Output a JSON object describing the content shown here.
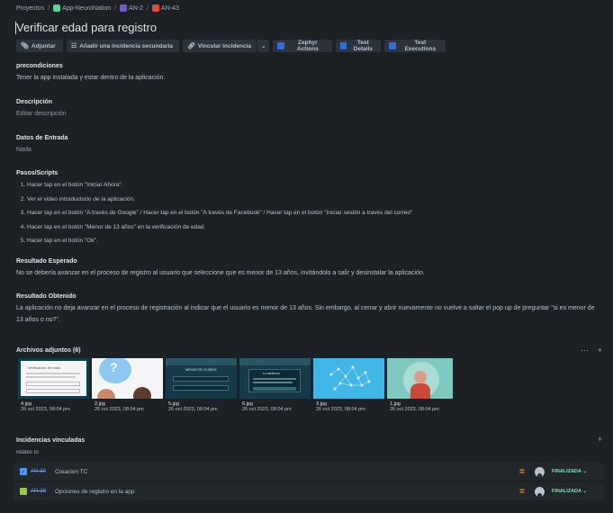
{
  "breadcrumb": {
    "projects": "Proyectos",
    "sep": "/",
    "app": "App-NeuroNation",
    "parent": "AN-2",
    "issue": "AN-43"
  },
  "title": "Verificar edad para registro",
  "toolbar": {
    "attach": "Adjuntar",
    "child": "Añadir una incidencia secundaria",
    "link": "Vincular incidencia",
    "zephyr": "Zephyr Actions",
    "details": "Test Details",
    "executions": "Test Executions"
  },
  "fields": {
    "preconditions_label": "precondiciones",
    "preconditions_value": "Tener la app instalada y estar dentro de la aplicación.",
    "description_label": "Descripción",
    "description_value": "Editar descripción",
    "input_label": "Datos de Entrada",
    "input_value": "Nada",
    "steps_label": "Pasos/Scripts",
    "steps": [
      "Hacer tap en el botón \"Iniciar Ahora\".",
      "Ver el video introductorio de la aplicación.",
      "Hacer tap en el botón \"A través de Google\" / Hacer tap  en el botón  \"A través de Facebook\" / Hacer tap  en el botón  \"Iniciar sesión a través del correo\"",
      "Hacer tap en el botón \"Menor de 13 años\" en la verificación de edad.",
      "Hacer tap en el botón \"Ok\"."
    ],
    "expected_label": "Resultado Esperado",
    "expected_value": "No se debería avanzar en el proceso de registro al usuario que seleccione que es menor de 13 años, invitándolo a salir y desinstalar la aplicación.",
    "obtained_label": "Resultado Obtenido",
    "obtained_value": "La aplicación no deja avanzar en el proceso de registración al indicar que el usuario es menor de 13 años. Sin embargo, al cerrar y abrir nuevamente no vuelve a saltar el pop up de preguntar \"si es menor de 13 años o no?\"."
  },
  "attachments": {
    "header": "Archivos adjuntos (6)",
    "more": "···",
    "add": "+",
    "items": [
      {
        "name": "4.jpg",
        "date": "26 oct 2023, 08:04 pm"
      },
      {
        "name": "2.jpg",
        "date": "26 oct 2023, 08:04 pm"
      },
      {
        "name": "5.jpg",
        "date": "26 oct 2023, 08:04 pm"
      },
      {
        "name": "6.jpg",
        "date": "26 oct 2023, 08:04 pm"
      },
      {
        "name": "3.jpg",
        "date": "26 oct 2023, 08:04 pm"
      },
      {
        "name": "1.jpg",
        "date": "26 oct 2023, 08:04 pm"
      }
    ]
  },
  "linked": {
    "header": "Incidencias vinculadas",
    "add": "+",
    "relation": "relates to",
    "items": [
      {
        "key": "AN-30",
        "summary": "Creacion TC",
        "priority": "=",
        "status": "FINALIZADA ⌄",
        "type_color": "#4c9aff"
      },
      {
        "key": "AN-28",
        "summary": "Opciones de registro en la app",
        "priority": "=",
        "status": "FINALIZADA ⌄",
        "type_color": "#94c748"
      }
    ]
  },
  "colors": {
    "background": "#1d2125",
    "button": "#2c333a",
    "link": "#579dff",
    "status_done": "#7ee2b8",
    "priority": "#f5a623"
  },
  "thumb_texts": {
    "t1_title": "Verificación de edad",
    "t3_title": "MENOR DE 13 AÑOS",
    "t4_title": "Lo sentimos"
  }
}
